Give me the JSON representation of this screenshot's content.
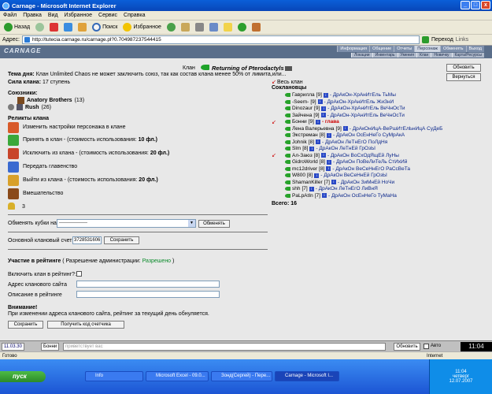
{
  "window": {
    "title": "Carnage - Microsoft Internet Explorer",
    "min": "_",
    "max": "□",
    "close": "x"
  },
  "menu": [
    "Файл",
    "Правка",
    "Вид",
    "Избранное",
    "Сервис",
    "Справка"
  ],
  "toolbar": {
    "back": "Назад",
    "search": "Поиск",
    "favorites": "Избранное",
    "go": "Переход",
    "links": "Links"
  },
  "address": {
    "label": "Адрес:",
    "url": "http://tutecia.carnage.ru/carnage.pl?0.704987237544415"
  },
  "game": {
    "logo": "CARNAGE",
    "nav1": [
      "Информация",
      "Общение",
      "Отчеты",
      "Персонаж",
      "Обменять",
      "Выход"
    ],
    "nav2": [
      "Локации",
      "Инвентарь",
      "Умения",
      "Клан",
      "Новичку",
      "Карта/Ресурсы"
    ]
  },
  "clan": {
    "label": "Клан",
    "name": "Returning of Pterodactyls",
    "theme_label": "Тема дня:",
    "theme_text": "Клан Unlimited Chaos не может заключить союз, так как состав клана менее 50% от лимита,или...",
    "power_label": "Сила клана:",
    "power_value": "17 ступень",
    "allies_title": "Союзники:",
    "allies": [
      {
        "name": "Anatory Brothers",
        "count": "(13)"
      },
      {
        "name": "Rush",
        "count": "(26)"
      }
    ],
    "relics_title": "Реликты клана",
    "actions": [
      {
        "text": "Изменить настройки персонажа в клане",
        "bold": ""
      },
      {
        "text": "Принять в клан - (стоимость использования: ",
        "bold": "10 фл.)"
      },
      {
        "text": "Исключить из клана - (стоимость использования: ",
        "bold": "20 фл.)"
      },
      {
        "text": "Передать главенство",
        "bold": ""
      },
      {
        "text": "Выйти из клана - (стоимость использования: ",
        "bold": "20 фл.)"
      },
      {
        "text": "Вмешательство",
        "bold": ""
      }
    ],
    "trophy_count": "3",
    "exchange_label": "Обменять кубки на",
    "exchange_select": "------------------",
    "exchange_button": "Обменять",
    "account_label": "Основной клановый счет:",
    "account_value": "3728531606",
    "save_button": "Сохранить",
    "rating_title": "Участие в рейтинге",
    "rating_permit": "( Разрешение администрации:",
    "rating_status": "Разрешено",
    "rating_close": ")",
    "include_label": "Включить клан в рейтинг?:",
    "site_label": "Адрес кланового сайта",
    "desc_label": "Описание в рейтинге",
    "warning_title": "Внимание!",
    "warning_text": "При изменении адреса кланового сайта, рейтинг за текущий день обнуляется.",
    "save2_button": "Сохранить",
    "counter_button": "Получить код счетчика",
    "refresh_button": "Обновить",
    "back_button": "Вернуться",
    "members_title": "Соклановцы",
    "members_total_label": "Всего:",
    "members_total": "16",
    "members_marker": "Весь клан",
    "members": [
      {
        "name": "Гаврилла",
        "lvl": "[9]",
        "title": "- ДрАкОн-ХрАнИтЕль ТьМы",
        "head": false,
        "arrow": false
      },
      {
        "name": "-Seem-",
        "lvl": "[9]",
        "title": "- ДрАкОн-ХрАнИтЕль ЖиЗнИ",
        "head": false,
        "arrow": false
      },
      {
        "name": "Dinozaur",
        "lvl": "[9]",
        "title": "- ДрАкОн-ХрАнИтЕль ВеЧнОсТи",
        "head": false,
        "arrow": false
      },
      {
        "name": "Зайчена",
        "lvl": "[9]",
        "title": "- ДрАкОн-ХрАнИтЕль ВеЧнОсТи",
        "head": false,
        "arrow": false
      },
      {
        "name": "Бонни",
        "lvl": "[9]",
        "title": "- глава",
        "head": true,
        "arrow": true
      },
      {
        "name": "Лена Валерьевна",
        "lvl": "[9]",
        "title": "- ДрАкОнИцА-ВеРшИтЕлЬнИцА СуДеБ",
        "head": false,
        "arrow": false
      },
      {
        "name": "Экстреман",
        "lvl": "[8]",
        "title": "- ДрАкОн ОсЕнНеГо СуМрАкА",
        "head": false,
        "arrow": false
      },
      {
        "name": "Johnik",
        "lvl": "[8]",
        "title": "- ДрАкОн ЛеТнЕгО ПоЛдНя",
        "head": false,
        "arrow": false
      },
      {
        "name": "Slm",
        "lvl": "[8]",
        "title": "- ДрАкОн ЛеТнЕй ГрОзЫ",
        "head": false,
        "arrow": false
      },
      {
        "name": "Ал-Заюз",
        "lvl": "[8]",
        "title": "- ДрАкОн ВоСхОдЯщЕй ЛуНы",
        "head": false,
        "arrow": true
      },
      {
        "name": "GidroWorld",
        "lvl": "[8]",
        "title": "- ДрАкОн ПоВеЛиТеЛь СтИхИй",
        "head": false,
        "arrow": false
      },
      {
        "name": "mc12driver",
        "lvl": "[8]",
        "title": "- ДрАкОн ВеСеНнЕгО РаСсВеТа",
        "head": false,
        "arrow": false
      },
      {
        "name": "W800",
        "lvl": "[8]",
        "title": "- ДрАкОн ВеСеНнЕй ГрОзЫ",
        "head": false,
        "arrow": false
      },
      {
        "name": "ShamanKiller",
        "lvl": "[7]",
        "title": "- ДрАкОн ЗиМнЕй НоЧи",
        "head": false,
        "arrow": false
      },
      {
        "name": "shh",
        "lvl": "[7]",
        "title": "- ДрАкОн ЛеТнЕгО ЛиВнЯ",
        "head": false,
        "arrow": false
      },
      {
        "name": "PaLpAtIn",
        "lvl": "[7]",
        "title": "- ДрАкОн ОсЕнНеГо ТуМаНа",
        "head": false,
        "arrow": false
      }
    ]
  },
  "chat": {
    "clock": "11.03.30",
    "name": "Бонни",
    "message": "приветствует вас",
    "refresh": "Обновить",
    "auto": "Авто",
    "time": "11:04"
  },
  "status": {
    "ready": "Готово",
    "zone": "Internet"
  },
  "taskbar": {
    "start": "пуск",
    "tasks": [
      "Info",
      "Microsoft Excel - 09.0...",
      "Зонд(Сергей) - Пере...",
      "Carnage - Microsoft I..."
    ],
    "clock": "11:04",
    "day": "четверг",
    "date": "12.07.2007"
  }
}
